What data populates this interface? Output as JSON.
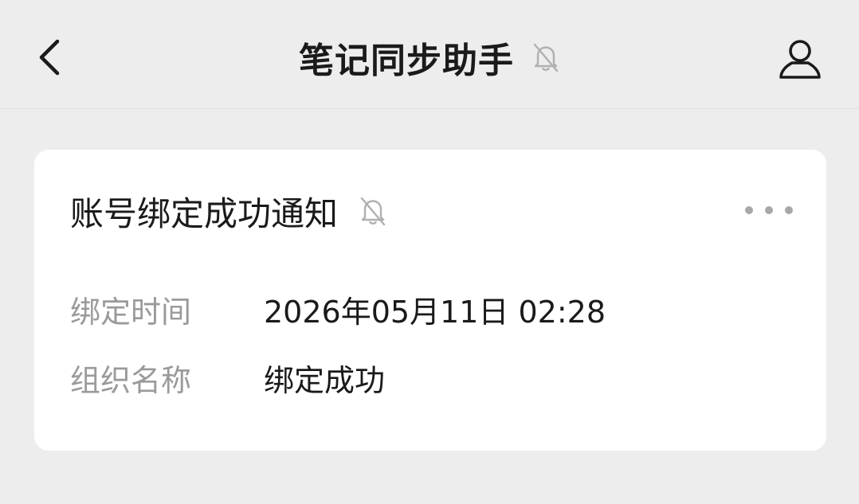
{
  "header": {
    "back_icon": "chevron-left-icon",
    "title": "笔记同步助手",
    "mute_icon": "bell-off-icon",
    "profile_icon": "user-icon"
  },
  "message_card": {
    "title": "账号绑定成功通知",
    "mute_icon": "bell-off-icon",
    "more_icon": "more-dots-icon",
    "fields": [
      {
        "label": "绑定时间",
        "value": "2026年05月11日 02:28"
      },
      {
        "label": "组织名称",
        "value": "绑定成功"
      }
    ]
  },
  "colors": {
    "background": "#ededed",
    "card": "#ffffff",
    "text_primary": "#1a1a1a",
    "text_secondary": "#9a9a9a",
    "icon_muted": "#b0b0b0"
  }
}
